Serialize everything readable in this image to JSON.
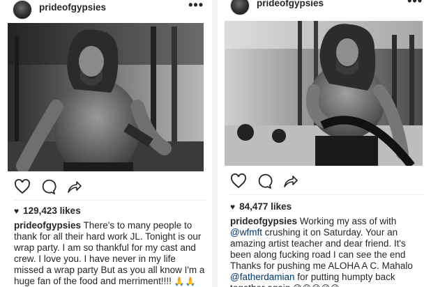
{
  "posts": [
    {
      "username": "prideofgypsies",
      "more_label": "•••",
      "likes": "129,423 likes",
      "caption_user": "prideofgypsies",
      "caption_text": "There's to many people to thank for all their hard work  JL. Tonight is our wrap party.  I am so thankful for my cast and crew. I love you.  I have never in my life missed a wrap party  But as you all know I'm a huge fan of the food and merriment!!!!",
      "caption_emojis": "🙏🙏🙏🙏🙏😈😈😈😈😈😜😜😜😜😜",
      "icons": [
        "heart-icon",
        "comment-icon",
        "share-icon"
      ]
    },
    {
      "username": "prideofgypsies",
      "more_label": "•••",
      "likes": "84,477 likes",
      "caption_user": "prideofgypsies",
      "caption_part1": "Working my ass of with ",
      "mention1": "@wfmft",
      "caption_part2": " crushing it on Saturday. Your an amazing artist teacher and dear friend. It's been along fucking road I can see the end Thanks for pushing me  ALOHA A C. Mahalo ",
      "mention2": "@fatherdamian",
      "caption_part3": " for putting humpty back together again ",
      "caption_emojis": "😜😜😜😜😜",
      "icons": [
        "heart-icon",
        "comment-icon",
        "share-icon"
      ]
    }
  ]
}
